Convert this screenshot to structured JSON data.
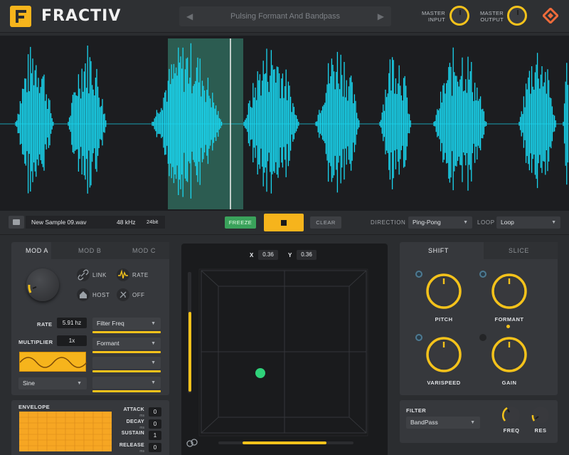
{
  "header": {
    "app_name": "FRACTIV",
    "preset_name": "Pulsing Formant And Bandpass",
    "master_input_label": "MASTER\nINPUT",
    "master_output_label": "MASTER\nOUTPUT",
    "prev_icon": "triangle-left-icon",
    "next_icon": "triangle-right-icon",
    "logo_color": "#f6b41c"
  },
  "waveform": {
    "color": "#19d6f0",
    "selection_color": "#3b8f7a"
  },
  "transport": {
    "file_name": "New Sample 09.wav",
    "sample_rate": "48 kHz",
    "bit_depth": "24bit",
    "freeze_label": "FREEZE",
    "clear_label": "CLEAR",
    "direction_label": "DIRECTION",
    "direction_value": "Ping-Pong",
    "loop_label": "LOOP",
    "loop_value": "Loop"
  },
  "mod": {
    "tabs": [
      "MOD A",
      "MOD B",
      "MOD C"
    ],
    "link_label": "LINK",
    "rate_toggle_label": "RATE",
    "host_label": "HOST",
    "off_label": "OFF",
    "rate_label": "RATE",
    "rate_value": "5.91 hz",
    "multiplier_label": "MULTIPLIER",
    "multiplier_value": "1x",
    "shape_value": "Sine",
    "destinations": [
      "Filter Freq",
      "Formant",
      "",
      ""
    ],
    "envelope_label": "ENVELOPE",
    "attack_label": "ATTACK",
    "attack_unit": "ms",
    "attack_value": "0",
    "decay_label": "DECAY",
    "decay_unit": "ms",
    "decay_value": "0",
    "sustain_label": "SUSTAIN",
    "sustain_value": "1",
    "release_label": "RELEASE",
    "release_unit": "ms",
    "release_value": "0"
  },
  "xy": {
    "x_label": "X",
    "x_value": "0.36",
    "y_label": "Y",
    "y_value": "0.36"
  },
  "shift": {
    "tabs": [
      "SHIFT",
      "SLICE"
    ],
    "knobs": [
      "PITCH",
      "FORMANT",
      "VARISPEED",
      "GAIN"
    ],
    "filter_label": "FILTER",
    "filter_type": "BandPass",
    "freq_label": "FREQ",
    "res_label": "RES"
  },
  "colors": {
    "accent": "#f4c21b",
    "panel": "#36383c",
    "xy_dot": "#2fd27a"
  }
}
